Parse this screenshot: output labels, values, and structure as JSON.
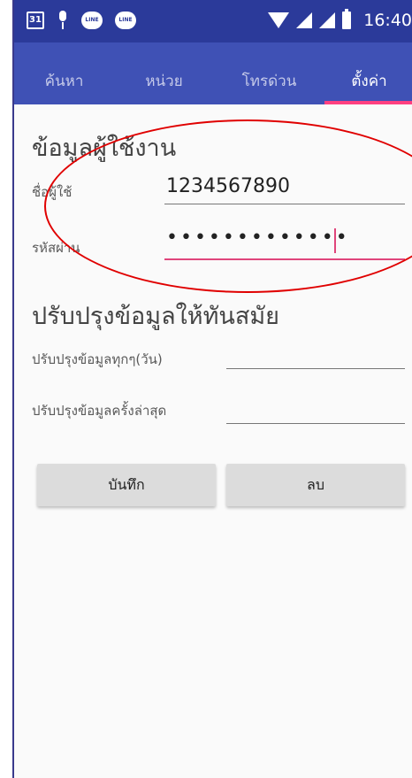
{
  "status_bar": {
    "calendar_day": "31",
    "line_badge_1": "LINE",
    "line_badge_2": "LINE",
    "time": "16:40"
  },
  "tabs": [
    {
      "label": "ค้นหา",
      "active": false
    },
    {
      "label": "หน่วย",
      "active": false
    },
    {
      "label": "โทรด่วน",
      "active": false
    },
    {
      "label": "ตั้งค่า",
      "active": true
    }
  ],
  "user_section": {
    "title": "ข้อมูลผู้ใช้งาน",
    "username_label": "ชื่อผู้ใช้",
    "username_value": "1234567890",
    "password_label": "รหัสผ่าน",
    "password_masked": "•••••••••••••"
  },
  "update_section": {
    "title": "ปรับปรุงข้อมูลให้ทันสมัย",
    "interval_label": "ปรับปรุงข้อมูลทุกๆ(วัน)",
    "interval_value": "",
    "last_update_label": "ปรับปรุงข้อมูลครั้งล่าสุด",
    "last_update_value": ""
  },
  "buttons": {
    "save": "บันทึก",
    "delete": "ลบ"
  },
  "colors": {
    "status_bar": "#2b3a9a",
    "tab_bar": "#3f51b5",
    "accent": "#ff4081",
    "annotation": "#e00000"
  }
}
